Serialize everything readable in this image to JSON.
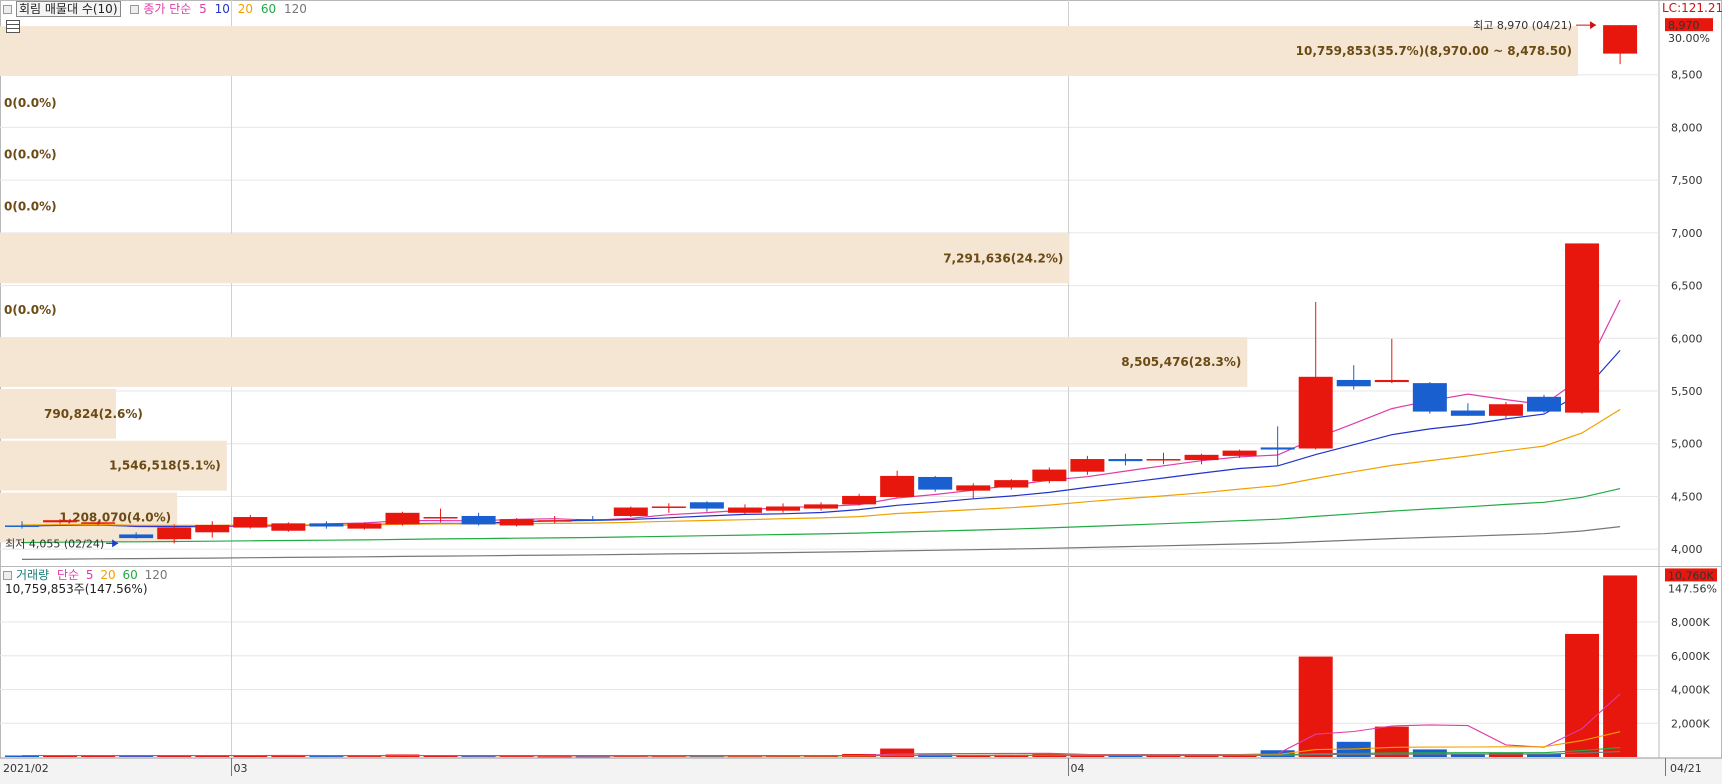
{
  "toolbar": {
    "indicator_label": "회림 매물대 수(10)",
    "ma_label": "종가 단순",
    "ma_periods": [
      "5",
      "10",
      "20",
      "60",
      "120"
    ],
    "ma_colors": [
      "#e03ca8",
      "#2233cc",
      "#f0a000",
      "#22aa44",
      "#777777"
    ],
    "lc_label": "LC:121.21"
  },
  "price_panel": {
    "current_price": "8,970",
    "change_pct": "30.00%",
    "high_label": "최고 8,970 (04/21)",
    "low_label": "최저 4,055 (02/24)",
    "y_ticks": [
      "8,500",
      "8,000",
      "7,500",
      "7,000",
      "6,500",
      "6,000",
      "5,500",
      "5,000",
      "4,500",
      "4,000"
    ]
  },
  "volume_panel": {
    "legend_name": "거래량",
    "legend_ma": "단순",
    "legend_periods": [
      "5",
      "20",
      "60",
      "120"
    ],
    "current_text": "10,759,853주(147.56%)",
    "current_volume": "10,760K",
    "current_pct": "147.56%",
    "y_ticks": [
      "8,000K",
      "6,000K",
      "4,000K",
      "2,000K"
    ]
  },
  "x_axis": {
    "ticks": [
      "2021/02",
      "03",
      "04"
    ],
    "last_date": "04/21"
  },
  "chart_data": {
    "type": "candlestick",
    "price_range": [
      3850,
      9000
    ],
    "volume_range_k": [
      0,
      11200
    ],
    "volume_profile": [
      {
        "label": "10,759,853(35.7%)(8,970.00 ~ 8,478.50)",
        "low": 8478.5,
        "high": 8970,
        "volume": 10759853,
        "pct": 35.7
      },
      {
        "label": "0(0.0%)",
        "low": 7987,
        "high": 8478.5,
        "volume": 0,
        "pct": 0.0
      },
      {
        "label": "0(0.0%)",
        "low": 7495.5,
        "high": 7987,
        "volume": 0,
        "pct": 0.0
      },
      {
        "label": "0(0.0%)",
        "low": 7004,
        "high": 7495.5,
        "volume": 0,
        "pct": 0.0
      },
      {
        "label": "7,291,636(24.2%)",
        "low": 6512.5,
        "high": 7004,
        "volume": 7291636,
        "pct": 24.2
      },
      {
        "label": "0(0.0%)",
        "low": 6021,
        "high": 6512.5,
        "volume": 0,
        "pct": 0.0
      },
      {
        "label": "8,505,476(28.3%)",
        "low": 5529.5,
        "high": 6021,
        "volume": 8505476,
        "pct": 28.3
      },
      {
        "label": "790,824(2.6%)",
        "low": 5038,
        "high": 5529.5,
        "volume": 790824,
        "pct": 2.6
      },
      {
        "label": "1,546,518(5.1%)",
        "low": 4546.5,
        "high": 5038,
        "volume": 1546518,
        "pct": 5.1
      },
      {
        "label": "1,208,070(4.0%)",
        "low": 4055,
        "high": 4546.5,
        "volume": 1208070,
        "pct": 4.0
      }
    ],
    "candles": [
      {
        "o": 4225,
        "h": 4265,
        "l": 4195,
        "c": 4220,
        "v": 90
      },
      {
        "o": 4255,
        "h": 4285,
        "l": 4240,
        "c": 4275,
        "v": 70
      },
      {
        "o": 4245,
        "h": 4265,
        "l": 4225,
        "c": 4255,
        "v": 60
      },
      {
        "o": 4140,
        "h": 4160,
        "l": 4100,
        "c": 4105,
        "v": 85
      },
      {
        "o": 4095,
        "h": 4235,
        "l": 4055,
        "c": 4205,
        "v": 110
      },
      {
        "o": 4160,
        "h": 4265,
        "l": 4110,
        "c": 4230,
        "v": 95
      },
      {
        "o": 4205,
        "h": 4325,
        "l": 4195,
        "c": 4305,
        "v": 100
      },
      {
        "o": 4175,
        "h": 4255,
        "l": 4165,
        "c": 4245,
        "v": 75
      },
      {
        "o": 4245,
        "h": 4265,
        "l": 4195,
        "c": 4215,
        "v": 55
      },
      {
        "o": 4195,
        "h": 4255,
        "l": 4185,
        "c": 4245,
        "v": 60
      },
      {
        "o": 4235,
        "h": 4355,
        "l": 4225,
        "c": 4345,
        "v": 150
      },
      {
        "o": 4305,
        "h": 4385,
        "l": 4255,
        "c": 4305,
        "v": 60
      },
      {
        "o": 4315,
        "h": 4345,
        "l": 4225,
        "c": 4235,
        "v": 55
      },
      {
        "o": 4225,
        "h": 4295,
        "l": 4215,
        "c": 4285,
        "v": 60
      },
      {
        "o": 4275,
        "h": 4315,
        "l": 4245,
        "c": 4275,
        "v": 40
      },
      {
        "o": 4285,
        "h": 4315,
        "l": 4265,
        "c": 4275,
        "v": 40
      },
      {
        "o": 4315,
        "h": 4405,
        "l": 4305,
        "c": 4395,
        "v": 70
      },
      {
        "o": 4395,
        "h": 4435,
        "l": 4345,
        "c": 4405,
        "v": 55
      },
      {
        "o": 4445,
        "h": 4455,
        "l": 4355,
        "c": 4385,
        "v": 55
      },
      {
        "o": 4345,
        "h": 4425,
        "l": 4335,
        "c": 4395,
        "v": 55
      },
      {
        "o": 4365,
        "h": 4435,
        "l": 4345,
        "c": 4405,
        "v": 70
      },
      {
        "o": 4385,
        "h": 4445,
        "l": 4365,
        "c": 4425,
        "v": 70
      },
      {
        "o": 4425,
        "h": 4525,
        "l": 4415,
        "c": 4505,
        "v": 180
      },
      {
        "o": 4495,
        "h": 4745,
        "l": 4485,
        "c": 4695,
        "v": 500
      },
      {
        "o": 4685,
        "h": 4695,
        "l": 4545,
        "c": 4565,
        "v": 160
      },
      {
        "o": 4555,
        "h": 4625,
        "l": 4475,
        "c": 4605,
        "v": 100
      },
      {
        "o": 4585,
        "h": 4665,
        "l": 4565,
        "c": 4655,
        "v": 140
      },
      {
        "o": 4645,
        "h": 4775,
        "l": 4625,
        "c": 4755,
        "v": 200
      },
      {
        "o": 4735,
        "h": 4885,
        "l": 4705,
        "c": 4855,
        "v": 160
      },
      {
        "o": 4855,
        "h": 4905,
        "l": 4795,
        "c": 4835,
        "v": 120
      },
      {
        "o": 4855,
        "h": 4915,
        "l": 4805,
        "c": 4855,
        "v": 120
      },
      {
        "o": 4845,
        "h": 4905,
        "l": 4805,
        "c": 4895,
        "v": 150
      },
      {
        "o": 4885,
        "h": 4945,
        "l": 4865,
        "c": 4935,
        "v": 150
      },
      {
        "o": 4965,
        "h": 5165,
        "l": 4785,
        "c": 4945,
        "v": 400
      },
      {
        "o": 4955,
        "h": 6345,
        "l": 4945,
        "c": 5635,
        "v": 5950
      },
      {
        "o": 5605,
        "h": 5745,
        "l": 5515,
        "c": 5545,
        "v": 900
      },
      {
        "o": 5585,
        "h": 5995,
        "l": 5575,
        "c": 5605,
        "v": 1800
      },
      {
        "o": 5575,
        "h": 5585,
        "l": 5285,
        "c": 5305,
        "v": 450
      },
      {
        "o": 5315,
        "h": 5385,
        "l": 5265,
        "c": 5265,
        "v": 200
      },
      {
        "o": 5265,
        "h": 5395,
        "l": 5245,
        "c": 5375,
        "v": 250
      },
      {
        "o": 5445,
        "h": 5465,
        "l": 5295,
        "c": 5305,
        "v": 200
      },
      {
        "o": 5295,
        "h": 6900,
        "l": 5285,
        "c": 6900,
        "v": 7292
      },
      {
        "o": 8700,
        "h": 8970,
        "l": 8600,
        "c": 8970,
        "v": 10760
      }
    ]
  }
}
